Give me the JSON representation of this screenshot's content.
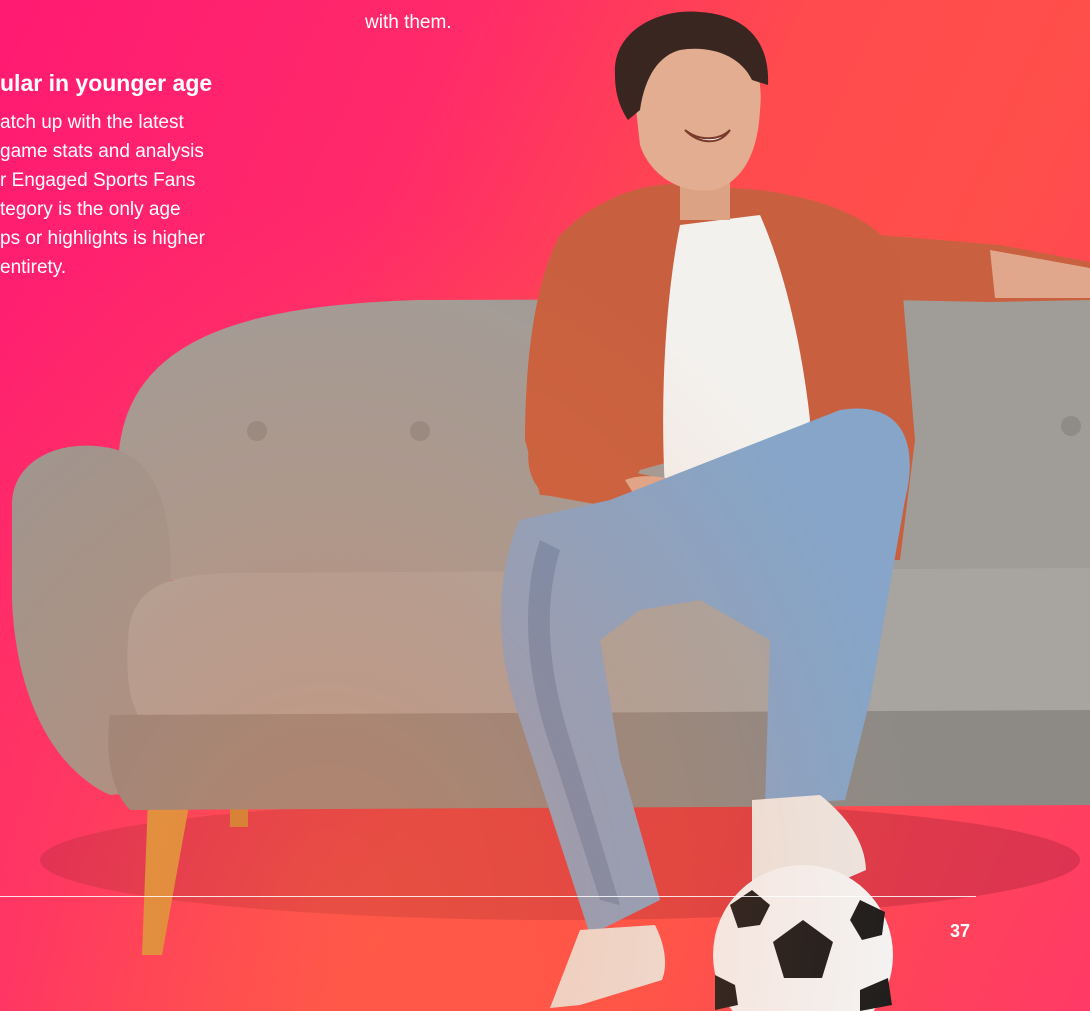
{
  "intro": {
    "tail": "with them."
  },
  "section": {
    "heading": "ular in younger age",
    "lines": [
      "atch up with the latest",
      "game stats and analysis",
      "r Engaged Sports Fans",
      "tegory is the only age",
      "ps or highlights is higher",
      "entirety."
    ]
  },
  "footer": {
    "page_number": "37"
  },
  "colors": {
    "background_left": "#ff1a72",
    "background_right": "#ff4f4a",
    "text": "#ffffff"
  }
}
